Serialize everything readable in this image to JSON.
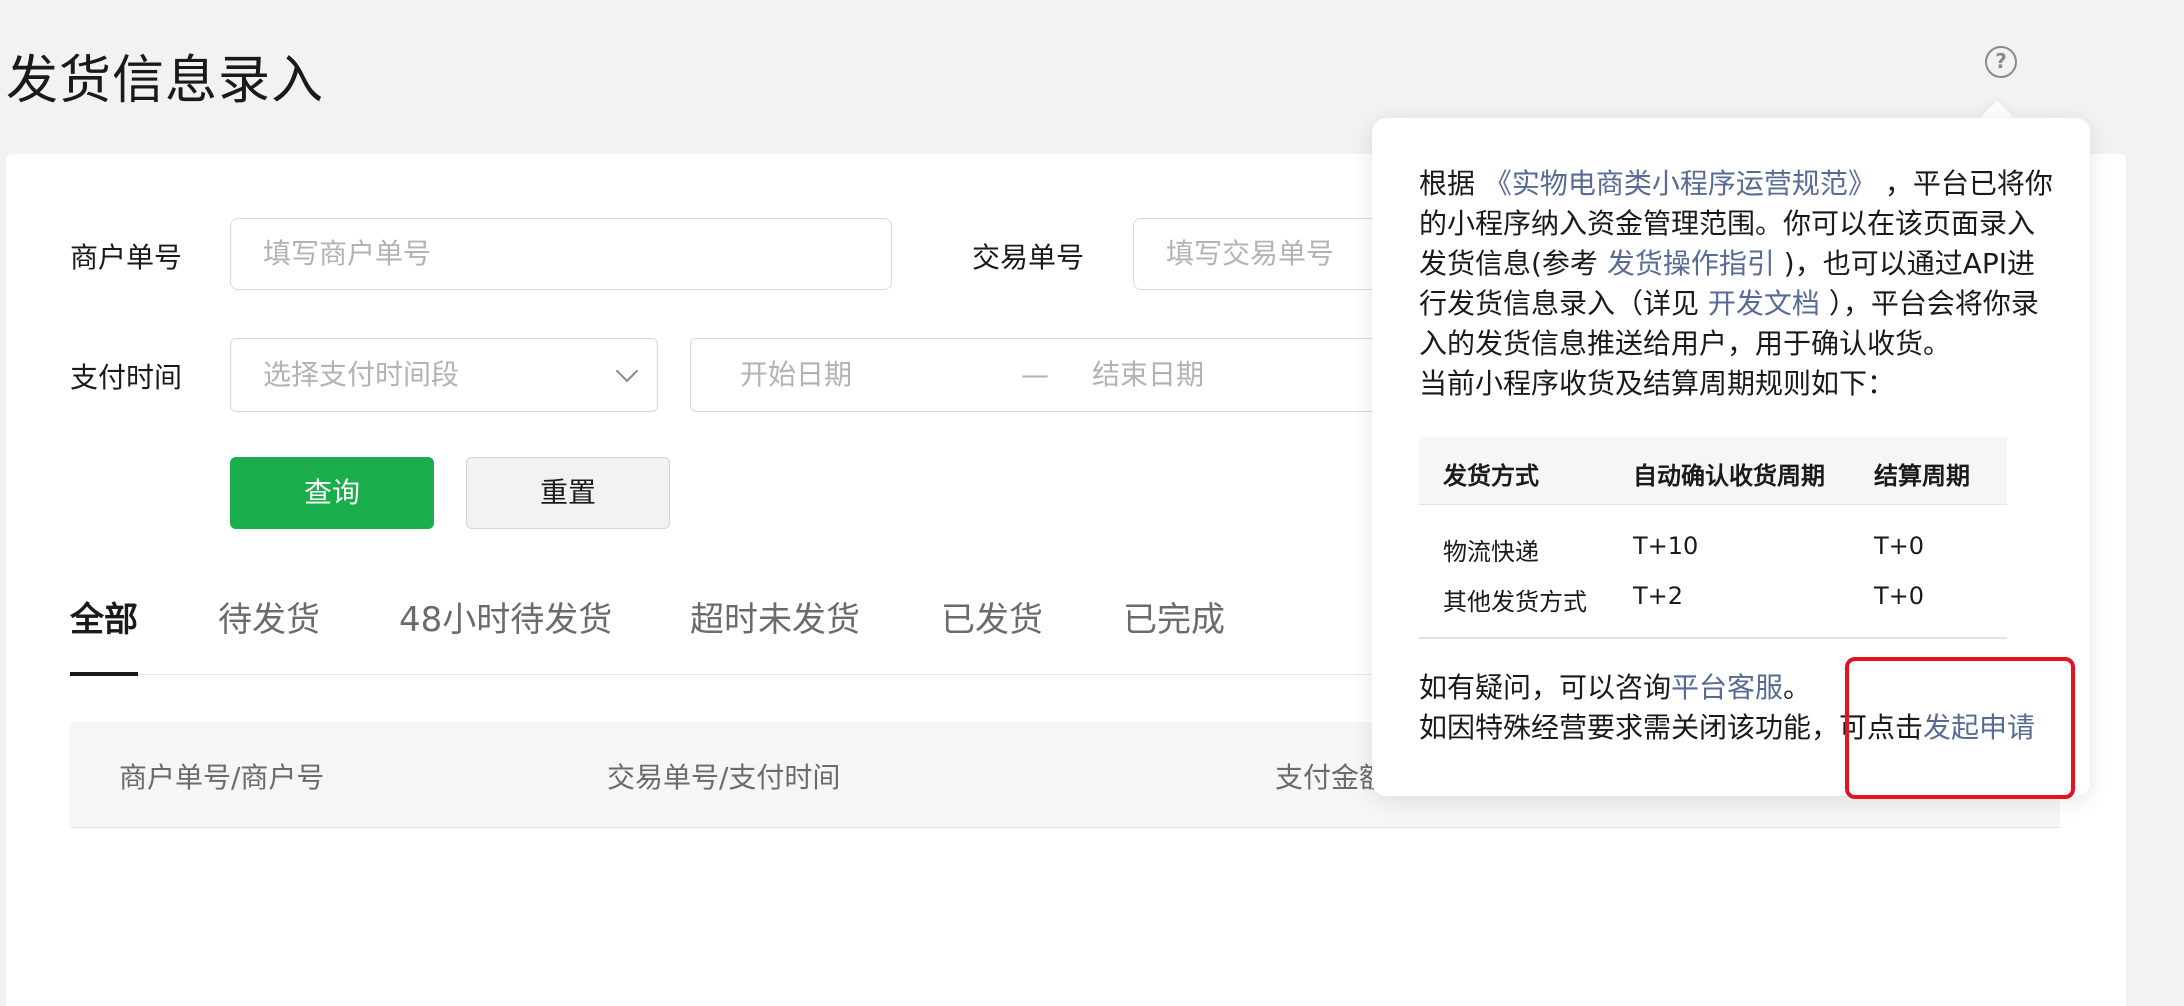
{
  "page": {
    "title": "发货信息录入"
  },
  "filters": {
    "merchant_order": {
      "label": "商户单号",
      "placeholder": "填写商户单号"
    },
    "trade_order": {
      "label": "交易单号",
      "placeholder": "填写交易单号"
    },
    "pay_time": {
      "label": "支付时间",
      "select_placeholder": "选择支付时间段",
      "start_placeholder": "开始日期",
      "separator": "—",
      "end_placeholder": "结束日期"
    },
    "query_button": "查询",
    "reset_button": "重置"
  },
  "tabs": [
    {
      "label": "全部",
      "active": true
    },
    {
      "label": "待发货",
      "active": false
    },
    {
      "label": "48小时待发货",
      "active": false
    },
    {
      "label": "超时未发货",
      "active": false
    },
    {
      "label": "已发货",
      "active": false
    },
    {
      "label": "已完成",
      "active": false
    }
  ],
  "table": {
    "columns": [
      "商户单号/商户号",
      "交易单号/支付时间",
      "支付金额"
    ]
  },
  "popover": {
    "p1_a": "根据",
    "p1_link1": "《实物电商类小程序运营规范》",
    "p1_b": "，平台已将你的小程序纳入资金管理范围。你可以在该页面录入发货信息(参考",
    "p1_link2": "发货操作指引",
    "p1_c": ")，也可以通过API进行发货信息录入（详见",
    "p1_link3": "开发文档",
    "p1_d": "），平台会将你录入的发货信息推送给用户，用于确认收货。",
    "p2": "当前小程序收货及结算周期规则如下：",
    "rules_table": {
      "headers": [
        "发货方式",
        "自动确认收货周期",
        "结算周期"
      ],
      "rows": [
        [
          "物流快递",
          "T+10",
          "T+0"
        ],
        [
          "其他发货方式",
          "T+2",
          "T+0"
        ]
      ]
    },
    "foot1_a": "如有疑问，可以咨询",
    "foot1_link": "平台客服",
    "foot1_b": "。",
    "foot2_a": "如因特殊经营要求需关闭该功能，可点击",
    "foot2_link": "发起申请"
  },
  "colors": {
    "primary": "#1aad4b",
    "link": "#576b95",
    "highlight": "#e5131c"
  }
}
